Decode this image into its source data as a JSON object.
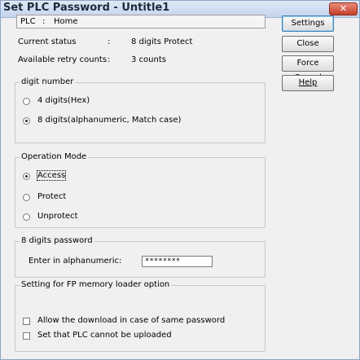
{
  "window": {
    "title": "Set PLC Password - Untitle1",
    "close_glyph": "✕"
  },
  "plc": {
    "label": "PLC",
    "separator": ":",
    "value": "Home"
  },
  "status": {
    "current_label": "Current status",
    "current_sep": ":",
    "current_value": "8 digits Protect",
    "retry_label": "Available retry counts",
    "retry_sep": ":",
    "retry_value": "3 counts"
  },
  "buttons": {
    "settings": "Settings",
    "close": "Close",
    "force_cancel": "Force Cancel",
    "help": "Help"
  },
  "digit_group": {
    "legend": "digit number",
    "options": [
      "4 digits(Hex)",
      "8 digits(alphanumeric, Match case)"
    ],
    "selected": "8 digits(alphanumeric, Match case)"
  },
  "mode_group": {
    "legend": "Operation Mode",
    "options": [
      "Access",
      "Protect",
      "Unprotect"
    ],
    "selected": "Access"
  },
  "password_group": {
    "legend": "8 digits password",
    "label": "Enter in alphanumeric:",
    "value": "********"
  },
  "loader_group": {
    "legend": "Setting for FP memory loader option",
    "options": [
      "Allow the download in case of same password",
      "Set that PLC cannot be uploaded"
    ],
    "checked": [
      false,
      false
    ]
  },
  "icons": {
    "radio": "radio-button-icon",
    "checkbox": "checkbox-icon",
    "close": "close-icon"
  }
}
